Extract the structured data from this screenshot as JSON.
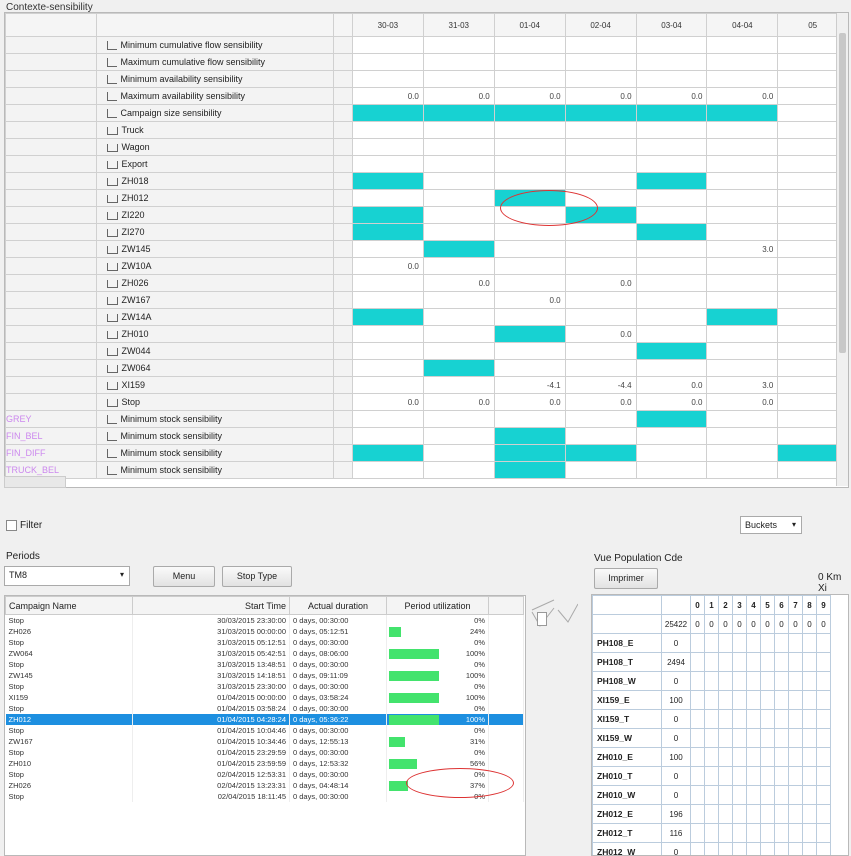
{
  "context_panel": {
    "title": "Contexte-sensibility",
    "dates": [
      "30-03",
      "31-03",
      "01-04",
      "02-04",
      "03-04",
      "04-04",
      "05"
    ],
    "rows": [
      {
        "group": "",
        "label": "Minimum cumulative flow sensibility",
        "icon": "sensibility-icon",
        "cells": [
          "",
          "",
          "",
          "",
          "",
          "",
          ""
        ]
      },
      {
        "group": "",
        "label": "Maximum cumulative flow sensibility",
        "icon": "sensibility-icon",
        "cells": [
          "",
          "",
          "",
          "",
          "",
          "",
          ""
        ]
      },
      {
        "group": "",
        "label": "Minimum availability sensibility",
        "icon": "sensibility-icon",
        "cells": [
          "",
          "",
          "",
          "",
          "",
          "",
          ""
        ]
      },
      {
        "group": "",
        "label": "Maximum availability sensibility",
        "icon": "sensibility-icon",
        "cells": [
          "0.0",
          "0.0",
          "0.0",
          "0.0",
          "0.0",
          "0.0",
          ""
        ]
      },
      {
        "group": "",
        "label": "Campaign size sensibility",
        "icon": "sensibility-icon",
        "cells": [
          "F",
          "F",
          "F",
          "F",
          "F",
          "F",
          ""
        ]
      },
      {
        "group": "",
        "label": "Truck",
        "icon": "tray-icon",
        "cells": [
          "",
          "",
          "",
          "",
          "",
          "",
          ""
        ]
      },
      {
        "group": "",
        "label": "Wagon",
        "icon": "tray-icon",
        "cells": [
          "",
          "",
          "",
          "",
          "",
          "",
          ""
        ]
      },
      {
        "group": "",
        "label": "Export",
        "icon": "tray-icon",
        "cells": [
          "",
          "",
          "",
          "",
          "",
          "",
          ""
        ]
      },
      {
        "group": "",
        "label": "ZH018",
        "icon": "tray-icon",
        "cells": [
          "F",
          "",
          "",
          "",
          "F",
          "",
          ""
        ]
      },
      {
        "group": "",
        "label": "ZH012",
        "icon": "tray-icon",
        "cells": [
          "",
          "",
          "F",
          "",
          "",
          "",
          ""
        ]
      },
      {
        "group": "",
        "label": "ZI220",
        "icon": "tray-icon",
        "cells": [
          "F",
          "",
          "",
          "F",
          "",
          "",
          ""
        ]
      },
      {
        "group": "",
        "label": "ZI270",
        "icon": "tray-icon",
        "cells": [
          "F",
          "",
          "",
          "",
          "F",
          "",
          ""
        ]
      },
      {
        "group": "",
        "label": "ZW145",
        "icon": "tray-icon",
        "cells": [
          "",
          "F",
          "",
          "",
          "",
          "3.0",
          ""
        ]
      },
      {
        "group": "",
        "label": "ZW10A",
        "icon": "tray-icon",
        "cells": [
          "0.0",
          "",
          "",
          "",
          "",
          "",
          ""
        ]
      },
      {
        "group": "",
        "label": "ZH026",
        "icon": "tray-icon",
        "cells": [
          "",
          "0.0",
          "",
          "0.0",
          "",
          "",
          ""
        ]
      },
      {
        "group": "",
        "label": "ZW167",
        "icon": "tray-icon",
        "cells": [
          "",
          "",
          "0.0",
          "",
          "",
          "",
          ""
        ]
      },
      {
        "group": "",
        "label": "ZW14A",
        "icon": "tray-icon",
        "cells": [
          "F",
          "",
          "",
          "",
          "",
          "F",
          ""
        ]
      },
      {
        "group": "",
        "label": "ZH010",
        "icon": "tray-icon",
        "cells": [
          "",
          "",
          "F",
          "0.0",
          "",
          "",
          ""
        ]
      },
      {
        "group": "",
        "label": "ZW044",
        "icon": "tray-icon",
        "cells": [
          "",
          "",
          "",
          "",
          "F",
          "",
          ""
        ]
      },
      {
        "group": "",
        "label": "ZW064",
        "icon": "tray-icon",
        "cells": [
          "",
          "F",
          "",
          "",
          "",
          "",
          ""
        ]
      },
      {
        "group": "",
        "label": "XI159",
        "icon": "tray-icon",
        "cells": [
          "",
          "",
          "-4.1",
          "-4.4",
          "0.0",
          "3.0",
          ""
        ]
      },
      {
        "group": "",
        "label": "Stop",
        "icon": "tray-icon",
        "cells": [
          "0.0",
          "0.0",
          "0.0",
          "0.0",
          "0.0",
          "0.0",
          ""
        ]
      },
      {
        "group": "GREY",
        "label": "Minimum stock sensibility",
        "icon": "sensibility-icon",
        "cells": [
          "",
          "",
          "",
          "",
          "F",
          "",
          ""
        ]
      },
      {
        "group": "FIN_BEL",
        "label": "Minimum stock sensibility",
        "icon": "sensibility-icon",
        "cells": [
          "",
          "",
          "F",
          "",
          "",
          "",
          ""
        ]
      },
      {
        "group": "FIN_DIFF",
        "label": "Minimum stock sensibility",
        "icon": "sensibility-icon",
        "cells": [
          "F",
          "",
          "F",
          "F",
          "",
          "",
          "F"
        ]
      },
      {
        "group": "TRUCK_BEL",
        "label": "Minimum stock sensibility",
        "icon": "sensibility-icon",
        "cells": [
          "",
          "",
          "F",
          "",
          "",
          "",
          ""
        ]
      }
    ]
  },
  "filter_label": "Filter",
  "buckets_select": "Buckets",
  "periods_label": "Periods",
  "periods_select": "TM8",
  "menu_button": "Menu",
  "stop_type_button": "Stop Type",
  "campaign_table": {
    "headers": [
      "Campaign Name",
      "Start Time",
      "Actual duration",
      "Period utilization"
    ],
    "rows": [
      {
        "name": "Stop",
        "start": "30/03/2015 23:30:00",
        "dur": "0 days, 00:30:00",
        "util": 0,
        "pct": "0%"
      },
      {
        "name": "ZH026",
        "start": "31/03/2015 00:00:00",
        "dur": "0 days, 05:12:51",
        "util": 24,
        "pct": "24%"
      },
      {
        "name": "Stop",
        "start": "31/03/2015 05:12:51",
        "dur": "0 days, 00:30:00",
        "util": 0,
        "pct": "0%"
      },
      {
        "name": "ZW064",
        "start": "31/03/2015 05:42:51",
        "dur": "0 days, 08:06:00",
        "util": 100,
        "pct": "100%"
      },
      {
        "name": "Stop",
        "start": "31/03/2015 13:48:51",
        "dur": "0 days, 00:30:00",
        "util": 0,
        "pct": "0%"
      },
      {
        "name": "ZW145",
        "start": "31/03/2015 14:18:51",
        "dur": "0 days, 09:11:09",
        "util": 100,
        "pct": "100%"
      },
      {
        "name": "Stop",
        "start": "31/03/2015 23:30:00",
        "dur": "0 days, 00:30:00",
        "util": 0,
        "pct": "0%"
      },
      {
        "name": "XI159",
        "start": "01/04/2015 00:00:00",
        "dur": "0 days, 03:58:24",
        "util": 100,
        "pct": "100%"
      },
      {
        "name": "Stop",
        "start": "01/04/2015 03:58:24",
        "dur": "0 days, 00:30:00",
        "util": 0,
        "pct": "0%"
      },
      {
        "name": "ZH012",
        "start": "01/04/2015 04:28:24",
        "dur": "0 days, 05:36:22",
        "util": 100,
        "pct": "100%",
        "selected": true
      },
      {
        "name": "Stop",
        "start": "01/04/2015 10:04:46",
        "dur": "0 days, 00:30:00",
        "util": 0,
        "pct": "0%"
      },
      {
        "name": "ZW167",
        "start": "01/04/2015 10:34:46",
        "dur": "0 days, 12:55:13",
        "util": 31,
        "pct": "31%"
      },
      {
        "name": "Stop",
        "start": "01/04/2015 23:29:59",
        "dur": "0 days, 00:30:00",
        "util": 0,
        "pct": "0%"
      },
      {
        "name": "ZH010",
        "start": "01/04/2015 23:59:59",
        "dur": "0 days, 12:53:32",
        "util": 56,
        "pct": "56%"
      },
      {
        "name": "Stop",
        "start": "02/04/2015 12:53:31",
        "dur": "0 days, 00:30:00",
        "util": 0,
        "pct": "0%"
      },
      {
        "name": "ZH026",
        "start": "02/04/2015 13:23:31",
        "dur": "0 days, 04:48:14",
        "util": 37,
        "pct": "37%"
      },
      {
        "name": "Stop",
        "start": "02/04/2015 18:11:45",
        "dur": "0 days, 00:30:00",
        "util": 0,
        "pct": "0%"
      }
    ]
  },
  "population": {
    "title": "Vue Population Cde",
    "print_button": "Imprimer",
    "km_label": "0 Km Xi",
    "digits": [
      "0",
      "1",
      "2",
      "3",
      "4",
      "5",
      "6",
      "7",
      "8",
      "9"
    ],
    "total": "25422",
    "total_digits": [
      "0",
      "0",
      "0",
      "0",
      "0",
      "0",
      "0",
      "0",
      "0",
      "0"
    ],
    "rows": [
      {
        "label": "PH108_E",
        "value": "0"
      },
      {
        "label": "PH108_T",
        "value": "2494"
      },
      {
        "label": "PH108_W",
        "value": "0"
      },
      {
        "label": "XI159_E",
        "value": "100"
      },
      {
        "label": "XI159_T",
        "value": "0"
      },
      {
        "label": "XI159_W",
        "value": "0"
      },
      {
        "label": "ZH010_E",
        "value": "100"
      },
      {
        "label": "ZH010_T",
        "value": "0"
      },
      {
        "label": "ZH010_W",
        "value": "0"
      },
      {
        "label": "ZH012_E",
        "value": "196"
      },
      {
        "label": "ZH012_T",
        "value": "116"
      },
      {
        "label": "ZH012_W",
        "value": "0"
      }
    ]
  },
  "colors": {
    "accent_fill": "#17d2d2",
    "selection": "#1d8fe0",
    "util_bar": "#43e36d",
    "annotation": "#d33333"
  }
}
